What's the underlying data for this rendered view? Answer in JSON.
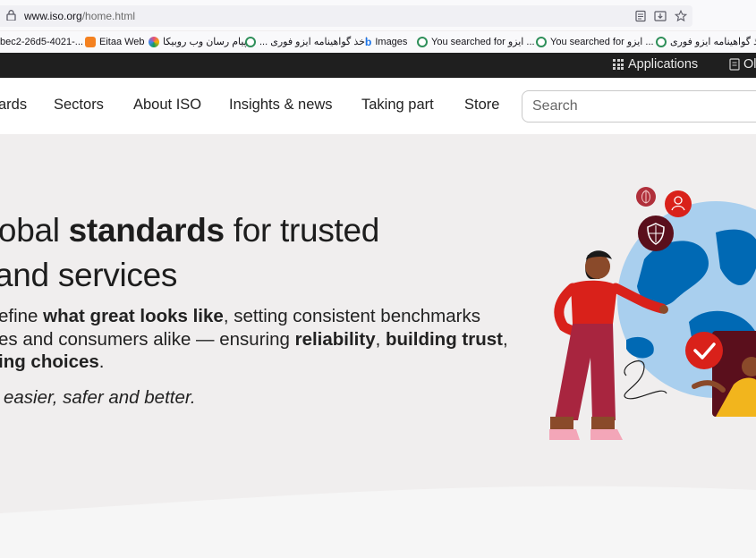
{
  "browser": {
    "url_host": "www.iso.org",
    "url_path": "/home.html",
    "bookmarks": [
      {
        "label": "bec2-26d5-4021-...",
        "color": "#ffffff"
      },
      {
        "label": "Eitaa Web",
        "color": "#f48120"
      },
      {
        "label": "پیام رسان وب روبیکا",
        "color": "#e94e77"
      },
      {
        "label": "... اخذ گواهینامه ایزو فوری",
        "color": "#2f8f5a"
      },
      {
        "label": "Images",
        "color": "#1a73e8"
      },
      {
        "label": "You searched for ایزو ...",
        "color": "#2f8f5a"
      },
      {
        "label": "You searched for ایزو ...",
        "color": "#2f8f5a"
      },
      {
        "label": "اخذ گواهینامه ایزو فوری",
        "color": "#2f8f5a"
      }
    ]
  },
  "topbar": {
    "applications_label": "Applications",
    "ol_label": "Ol"
  },
  "nav": {
    "items": [
      "ards",
      "Sectors",
      "About ISO",
      "Insights & news",
      "Taking part",
      "Store"
    ],
    "search_placeholder": "Search"
  },
  "hero": {
    "title_line1_pre": "lobal ",
    "title_line1_bold": "standards",
    "title_line1_post": " for trusted",
    "title_line2": "and services",
    "para_line1_pre": "efine ",
    "para_line1_bold": "what great looks like",
    "para_line1_post": ", setting consistent benchmarks",
    "para_line2_pre": "es and consumers alike — ensuring ",
    "para_line2_bold1": "reliability",
    "para_line2_mid": ", ",
    "para_line2_bold2": "building trust",
    "para_line2_post": ",",
    "para_line3_bold": "ing choices",
    "para_line3_post": ".",
    "tagline": "easier, safer and better."
  },
  "colors": {
    "accent": "#d9211a",
    "dark_maroon": "#5a0f1c",
    "globe_blue": "#0069b4",
    "globe_light": "#a9cfee",
    "hero_bg": "#f0eeee"
  }
}
